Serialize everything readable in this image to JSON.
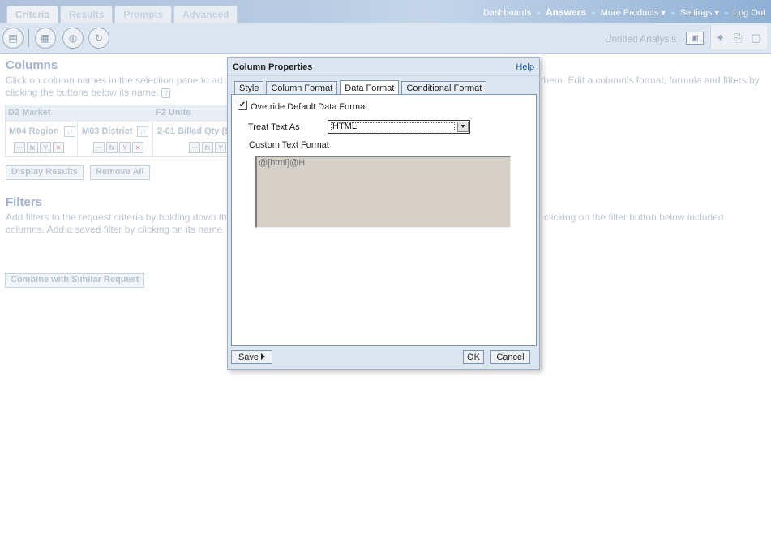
{
  "tabs": [
    {
      "label": "Criteria"
    },
    {
      "label": "Results"
    },
    {
      "label": "Prompts"
    },
    {
      "label": "Advanced"
    }
  ],
  "topnav": {
    "dashboards": "Dashboards",
    "answers": "Answers",
    "more_products": "More Products",
    "settings": "Settings",
    "logout": "Log Out",
    "sep": "-",
    "caret": "▾"
  },
  "toolbar": {
    "untitled": "Untitled Analysis"
  },
  "columns": {
    "title": "Columns",
    "instructions_left": "Click on column names in the selection pane to ad",
    "instructions_right": "them. Edit a column's format, formula and filters by",
    "instructions_line2": "clicking the buttons below its name.",
    "help": "?",
    "groups": [
      {
        "label": "D2 Market"
      },
      {
        "label": "F2 Units"
      }
    ],
    "cols": [
      {
        "name": "M04 Region"
      },
      {
        "name": "M03 District"
      },
      {
        "name": "2-01 Billed Qty (S"
      }
    ],
    "display_results": "Display Results",
    "remove_all": "Remove All"
  },
  "filters": {
    "title": "Filters",
    "text_left1": "Add filters to the request criteria by holding down th",
    "text_right1": "clicking on the filter button below included",
    "text_left2": "columns. Add a saved filter by clicking on its name"
  },
  "combine_button": "Combine with Similar Request",
  "dialog": {
    "title": "Column Properties",
    "help": "Help",
    "tabs": [
      {
        "label": "Style"
      },
      {
        "label": "Column Format"
      },
      {
        "label": "Data Format"
      },
      {
        "label": "Conditional Format"
      }
    ],
    "override_label": "Override Default Data Format",
    "override_checked": true,
    "checkmark": "✔",
    "treat_text_label": "Treat Text As",
    "treat_text_value": "HTML",
    "custom_format_label": "Custom Text Format",
    "custom_format_value": "@[html]@H",
    "save": "Save",
    "ok": "OK",
    "cancel": "Cancel"
  }
}
